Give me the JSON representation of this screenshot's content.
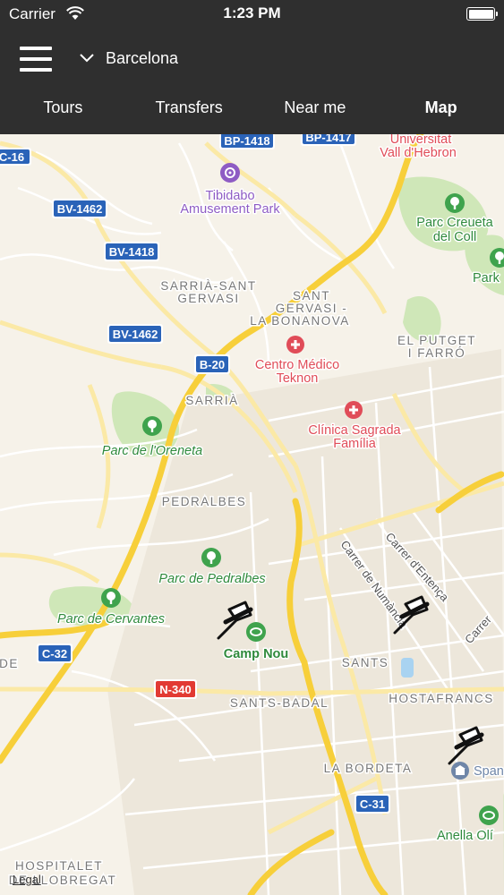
{
  "status_bar": {
    "carrier": "Carrier",
    "time": "1:23 PM",
    "wifi_icon": "wifi-icon",
    "battery_icon": "battery-icon"
  },
  "header": {
    "menu_icon": "hamburger-menu-icon",
    "city_dropdown_icon": "chevron-down-icon",
    "city": "Barcelona",
    "tabs": [
      {
        "label": "Tours",
        "active": false
      },
      {
        "label": "Transfers",
        "active": false
      },
      {
        "label": "Near me",
        "active": false
      },
      {
        "label": "Map",
        "active": true
      }
    ]
  },
  "map": {
    "road_shields": [
      {
        "text": "C-16",
        "color": "#2a63b8"
      },
      {
        "text": "BP-1418",
        "color": "#2a63b8"
      },
      {
        "text": "BP-1417",
        "color": "#2a63b8"
      },
      {
        "text": "BV-1462",
        "color": "#2a63b8"
      },
      {
        "text": "BV-1418",
        "color": "#2a63b8"
      },
      {
        "text": "BV-1462",
        "color": "#2a63b8"
      },
      {
        "text": "B-20",
        "color": "#2a63b8"
      },
      {
        "text": "C-32",
        "color": "#2a63b8"
      },
      {
        "text": "N-340",
        "color": "#e23a33"
      },
      {
        "text": "C-31",
        "color": "#2a63b8"
      }
    ],
    "pois": {
      "tibidabo_line1": "Tibidabo",
      "tibidabo_line2": "Amusement Park",
      "universitat_line1": "Universitat",
      "universitat_line2": "Vall d'Hebron",
      "creueta_line1": "Parc Creueta",
      "creueta_line2": "del Coll",
      "park_partial": "Park",
      "centro_line1": "Centro Médico",
      "centro_line2": "Teknon",
      "clinica_line1": "Clínica Sagrada",
      "clinica_line2": "Família",
      "oreneta": "Parc de l'Oreneta",
      "pedralbes_park": "Parc de Pedralbes",
      "cervantes": "Parc de Cervantes",
      "camp_nou": "Camp Nou",
      "spain_partial": "Span",
      "anella_partial": "Anella Olí"
    },
    "districts": {
      "sarria_sant_gervasi_1": "SARRIÀ-SANT",
      "sarria_sant_gervasi_2": "GERVASI",
      "sant_gervasi_1": "SANT",
      "sant_gervasi_2": "GERVASI -",
      "sant_gervasi_3": "LA BONANOVA",
      "putget_1": "EL PUTGET",
      "putget_2": "I FARRÓ",
      "sarria": "SARRIÀ",
      "pedralbes": "PEDRALBES",
      "sants": "SANTS",
      "sants_badal": "SANTS-BADAL",
      "hostafrancs": "HOSTAFRANCS",
      "la_bordeta": "LA BORDETA",
      "de_partial": "DE",
      "hospitalet_1": "HOSPITALET",
      "hospitalet_2": "DE LLOBREGAT"
    },
    "streets": {
      "numancia": "Carrer de Numància",
      "entenca": "Carrer d'Entença",
      "carrer_partial": "Carrer"
    },
    "pins": [
      "pushpin-icon",
      "pushpin-icon",
      "pushpin-icon"
    ],
    "legal": "Legal"
  },
  "colors": {
    "header_bg": "#2f2f2f",
    "map_bg": "#f6f2e9",
    "park": "#cfe7b8",
    "park_text": "#2f8a3c",
    "highway": "#f7cf3a",
    "medical_text": "#e04c58",
    "purple_text": "#8e5cc4"
  }
}
